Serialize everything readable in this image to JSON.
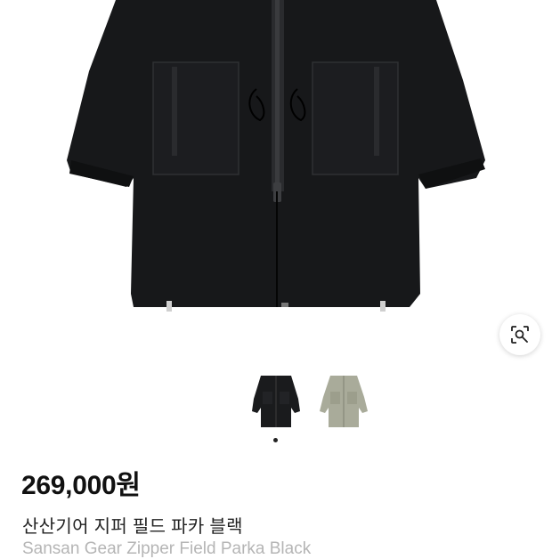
{
  "product": {
    "price": "269,000원",
    "name_ko": "산산기어 지퍼 필드 파카 블랙",
    "name_en": "Sansan Gear Zipper Field Parka Black"
  },
  "gallery": {
    "main_image": "black-field-parka-photo",
    "lens_icon": "visual-search-icon",
    "thumbnails": [
      {
        "color_name": "black",
        "color": "#1a1b1d",
        "selected": true
      },
      {
        "color_name": "khaki",
        "color": "#a9ab9a",
        "selected": false
      }
    ],
    "page_indicator_count": 1
  },
  "colors": {
    "accent": "#111111",
    "subtitle": "#b5b5b5",
    "parka": "#17181a"
  }
}
